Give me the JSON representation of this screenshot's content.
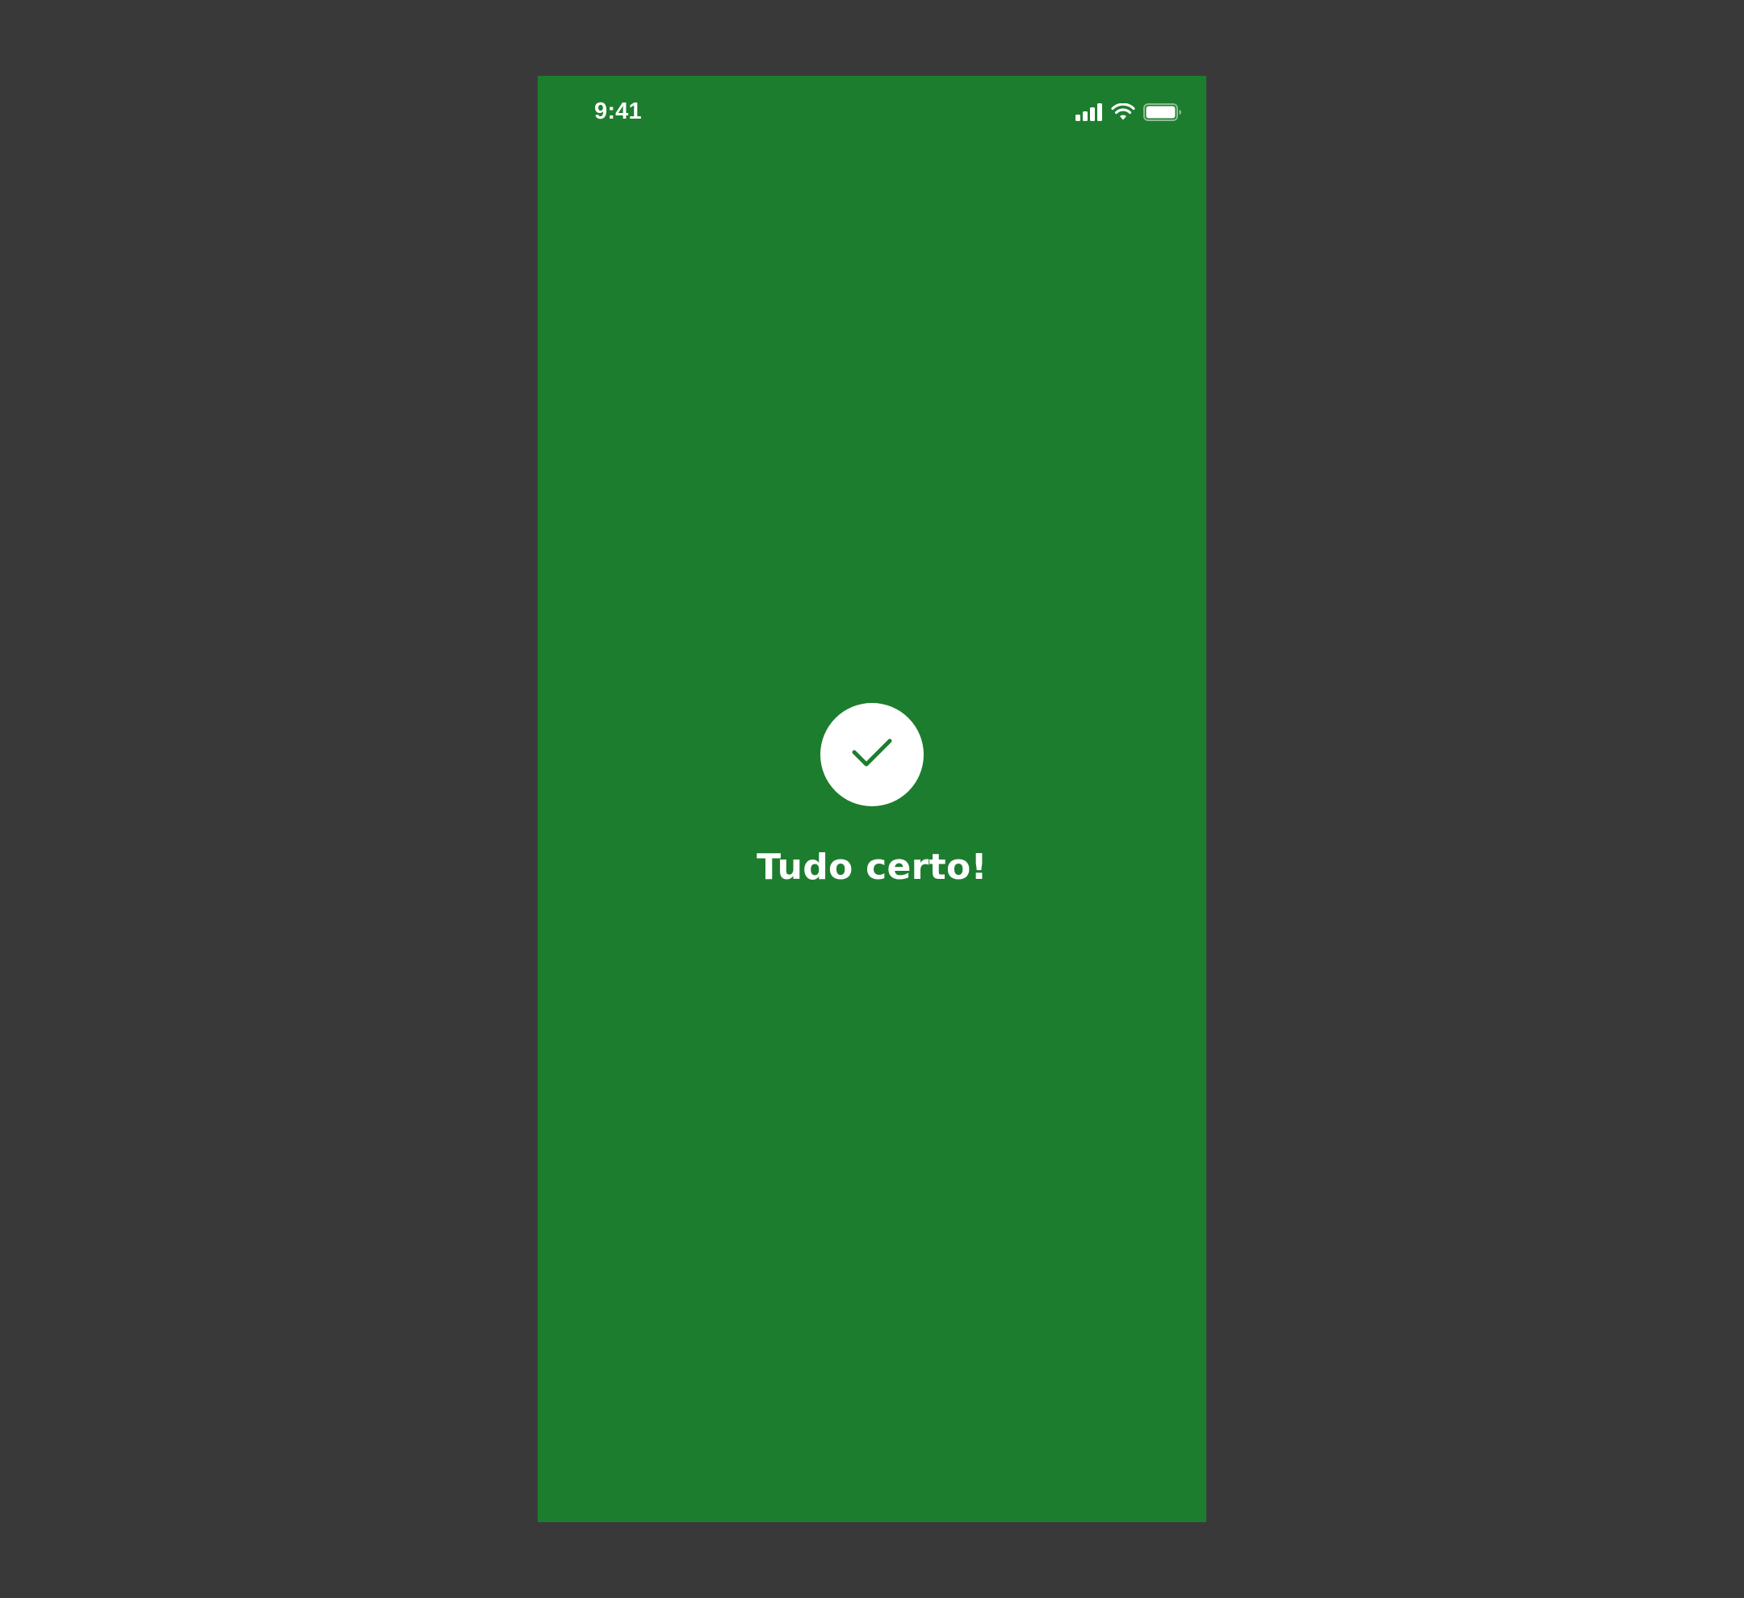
{
  "status_bar": {
    "time": "9:41",
    "icons": [
      "cellular-signal-icon",
      "wifi-icon",
      "battery-icon"
    ]
  },
  "success": {
    "icon": "checkmark-icon",
    "title": "Tudo certo!"
  },
  "colors": {
    "background": "#3a393a",
    "screen": "#1d7d2e",
    "foreground": "#ffffff"
  }
}
